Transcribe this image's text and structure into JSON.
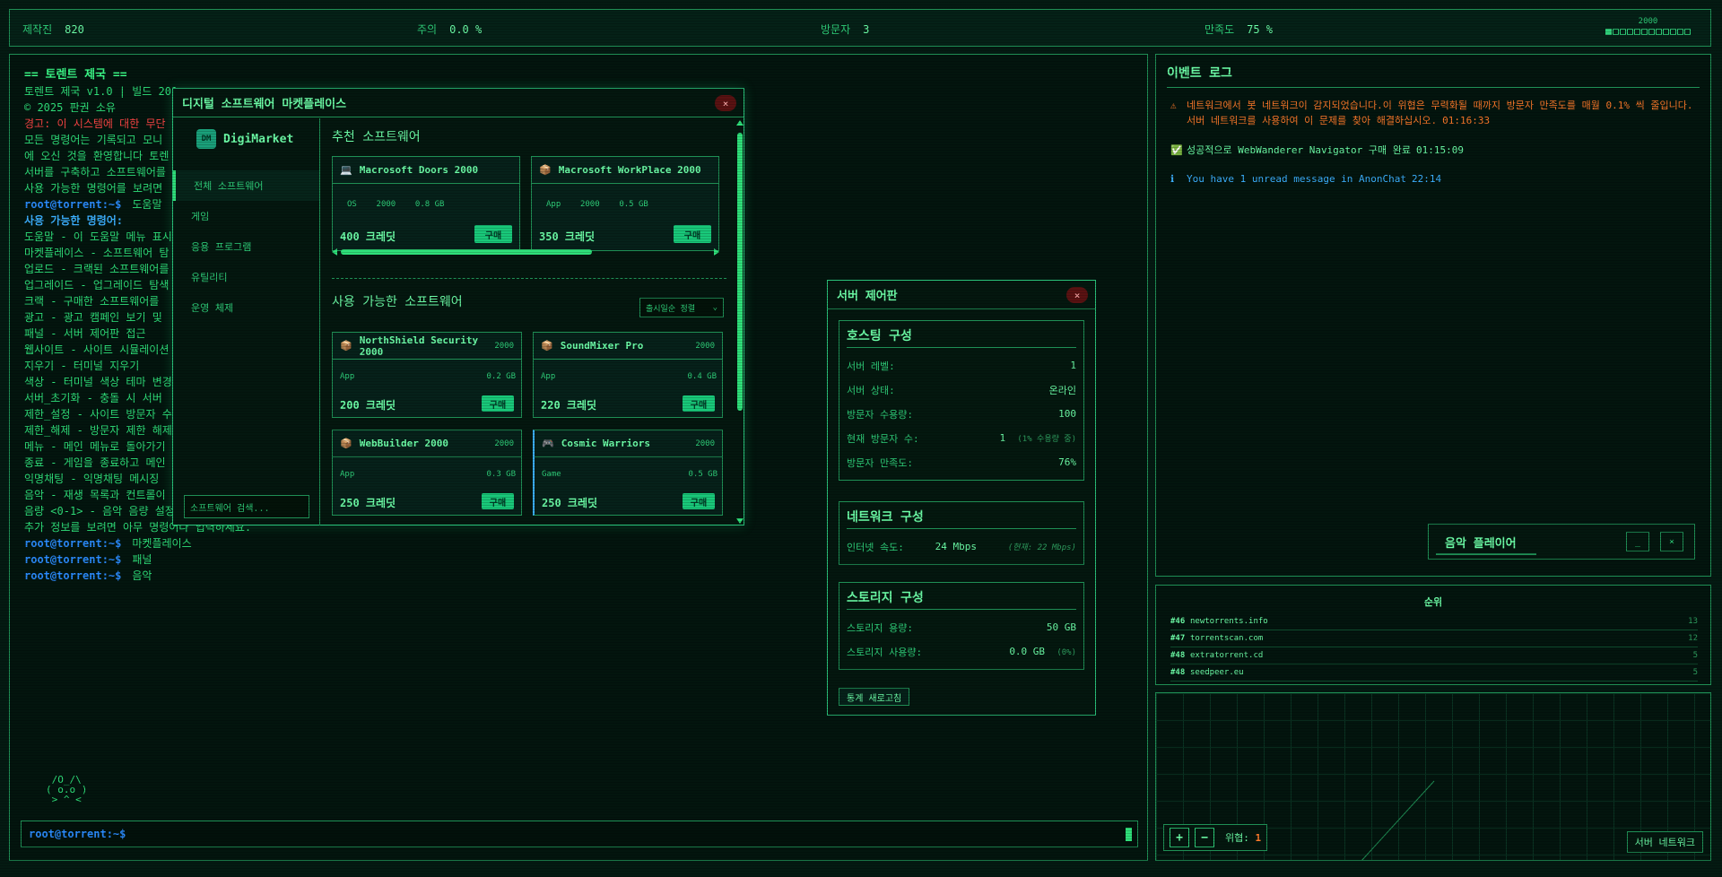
{
  "topbar": {
    "stats": [
      {
        "label": "제작진",
        "value": "820"
      },
      {
        "label": "주의",
        "value": "0.0 %"
      },
      {
        "label": "방문자",
        "value": "3"
      },
      {
        "label": "만족도",
        "value": "75 %"
      }
    ],
    "year": "2000"
  },
  "terminal": {
    "title": "== 토렌트 제국 ==",
    "lines": [
      {
        "text": "토렌트 제국 v1.0 | 빌드 201",
        "style": ""
      },
      {
        "text": "© 2025 판권 소유",
        "style": ""
      },
      {
        "text": "경고: 이 시스템에 대한 무단",
        "style": "warn"
      },
      {
        "text": "모든 명령어는 기록되고 모니",
        "style": ""
      },
      {
        "text": "에 오신 것을 환영합니다 토렌",
        "style": ""
      },
      {
        "text": "서버를 구축하고 소프트웨어를",
        "style": ""
      },
      {
        "text": "사용 가능한 명령어를 보려면",
        "style": ""
      },
      {
        "text": "도움말",
        "style": "prompt"
      },
      {
        "text": "사용 가능한 명령어:",
        "style": "sub"
      },
      {
        "text": "도움말 - 이 도움말 메뉴 표시",
        "style": ""
      },
      {
        "text": "마켓플레이스 - 소프트웨어 탐",
        "style": ""
      },
      {
        "text": "업로드 - 크랙된 소프트웨어를",
        "style": ""
      },
      {
        "text": "업그레이드 - 업그레이드 탐색",
        "style": ""
      },
      {
        "text": "크랙 - 구매한 소프트웨어를",
        "style": ""
      },
      {
        "text": "광고 - 광고 캠페인 보기 및",
        "style": ""
      },
      {
        "text": "패널 - 서버 제어판 접근",
        "style": ""
      },
      {
        "text": "웹사이트 - 사이트 시뮬레이션",
        "style": ""
      },
      {
        "text": "지우기 - 터미널 지우기",
        "style": ""
      },
      {
        "text": "색상 - 터미널 색상 테마 변경",
        "style": ""
      },
      {
        "text": "서버_초기화 - 충돌 시 서버",
        "style": ""
      },
      {
        "text": "제한_설정 - 사이트 방문자 수",
        "style": ""
      },
      {
        "text": "제한_해제 - 방문자 제한 해제",
        "style": ""
      },
      {
        "text": "메뉴 - 메인 메뉴로 돌아가기",
        "style": ""
      },
      {
        "text": "종료 - 게임을 종료하고 메인",
        "style": ""
      },
      {
        "text": "익명채팅 - 익명채팅 메시징",
        "style": ""
      },
      {
        "text": "음악 - 재생 목록과 컨트롤이",
        "style": ""
      },
      {
        "text": "음량 <0-1> - 음악 음량 설정",
        "style": ""
      },
      {
        "text": "추가 정보를 보려면 아무 명령어나 입력하세요.",
        "style": ""
      },
      {
        "text": "마켓플레이스",
        "style": "prompt"
      },
      {
        "text": "패널",
        "style": "prompt"
      },
      {
        "text": "음악",
        "style": "prompt"
      }
    ],
    "prompt": "root@torrent:~$",
    "ascii": " /O_/\\\n( o.o )\n > ^ <"
  },
  "marketplace": {
    "title": "디지털 소프트웨어 마켓플레이스",
    "close": "×",
    "logo_badge": "DM",
    "logo_name": "DigiMarket",
    "nav": [
      "전체 소프트웨어",
      "게임",
      "응용 프로그램",
      "유틸리티",
      "운영 체제"
    ],
    "search_placeholder": "소프트웨어 검색...",
    "featured_title": "추천 소프트웨어",
    "featured": [
      {
        "icon": "💻",
        "name": "Macrosoft Doors 2000",
        "type": "OS",
        "year": "2000",
        "size": "0.8 GB",
        "price": "400 크레딧",
        "buy": "구매"
      },
      {
        "icon": "📦",
        "name": "Macrosoft WorkPlace 2000",
        "type": "App",
        "year": "2000",
        "size": "0.5 GB",
        "price": "350 크레딧",
        "buy": "구매"
      }
    ],
    "available_title": "사용 가능한 소프트웨어",
    "sort_label": "출시일순 정렬",
    "available": [
      {
        "icon": "📦",
        "name": "NorthShield Security 2000",
        "year": "2000",
        "type": "App",
        "size": "0.2 GB",
        "price": "200 크레딧",
        "buy": "구매"
      },
      {
        "icon": "📦",
        "name": "SoundMixer Pro",
        "year": "2000",
        "type": "App",
        "size": "0.4 GB",
        "price": "220 크레딧",
        "buy": "구매"
      },
      {
        "icon": "📦",
        "name": "WebBuilder 2000",
        "year": "2000",
        "type": "App",
        "size": "0.3 GB",
        "price": "250 크레딧",
        "buy": "구매"
      },
      {
        "icon": "🎮",
        "name": "Cosmic Warriors",
        "year": "2000",
        "type": "Game",
        "size": "0.5 GB",
        "price": "250 크레딧",
        "buy": "구매"
      }
    ]
  },
  "server": {
    "title": "서버 제어판",
    "close": "×",
    "hosting": {
      "title": "호스팅 구성",
      "rows": [
        {
          "label": "서버 레벨:",
          "value": "1",
          "extra": ""
        },
        {
          "label": "서버 상태:",
          "value": "온라인",
          "extra": ""
        },
        {
          "label": "방문자 수용량:",
          "value": "100",
          "extra": ""
        },
        {
          "label": "현재 방문자 수:",
          "value": "1",
          "extra": "(1% 수용량 중)"
        },
        {
          "label": "방문자 만족도:",
          "value": "76%",
          "extra": ""
        }
      ]
    },
    "network": {
      "title": "네트워크 구성",
      "label": "인터넷 속도:",
      "value": "24 Mbps",
      "extra": "(현재: 22 Mbps)"
    },
    "storage": {
      "title": "스토리지 구성",
      "rows": [
        {
          "label": "스토리지 용량:",
          "value": "50 GB",
          "extra": ""
        },
        {
          "label": "스토리지 사용량:",
          "value": "0.0 GB",
          "extra": "(0%)"
        }
      ]
    },
    "refresh": "통계 새로고침"
  },
  "eventlog": {
    "title": "이벤트 로그",
    "events": [
      {
        "kind": "warn",
        "icon": "⚠",
        "text": "네트워크에서 봇 네트워크이 감지되었습니다.이 위협은 무력화될 때까지 방문자 만족도를 매월 0.1% 씩 줄입니다. 서버 네트워크를 사용하여 이 문제를 찾아 해결하십시오.",
        "time": "01:16:33"
      },
      {
        "kind": "ok",
        "icon": "✅",
        "text": "성공적으로 WebWanderer Navigator 구매 완료",
        "time": "01:15:09"
      },
      {
        "kind": "info",
        "icon": "ℹ",
        "text": "You have 1 unread message in AnonChat",
        "time": "22:14"
      }
    ]
  },
  "music": {
    "title": "음악 플레이어",
    "minimize": "_",
    "close": "×"
  },
  "rankings": {
    "title": "순위",
    "rows": [
      {
        "rank": "#46",
        "site": "newtorrents.info",
        "count": "13"
      },
      {
        "rank": "#47",
        "site": "torrentscan.com",
        "count": "12"
      },
      {
        "rank": "#48",
        "site": "extratorrent.cd",
        "count": "5"
      },
      {
        "rank": "#48",
        "site": "seedpeer.eu",
        "count": "5"
      }
    ]
  },
  "netmap": {
    "zoom_in": "+",
    "zoom_out": "−",
    "threat_label": "위협:",
    "threat_value": "1",
    "network_button": "서버 네트워크"
  },
  "colors": {
    "accent": "#2fe07a",
    "warning": "#ff7a2a",
    "error": "#ff4545",
    "info": "#3cb0ff"
  }
}
